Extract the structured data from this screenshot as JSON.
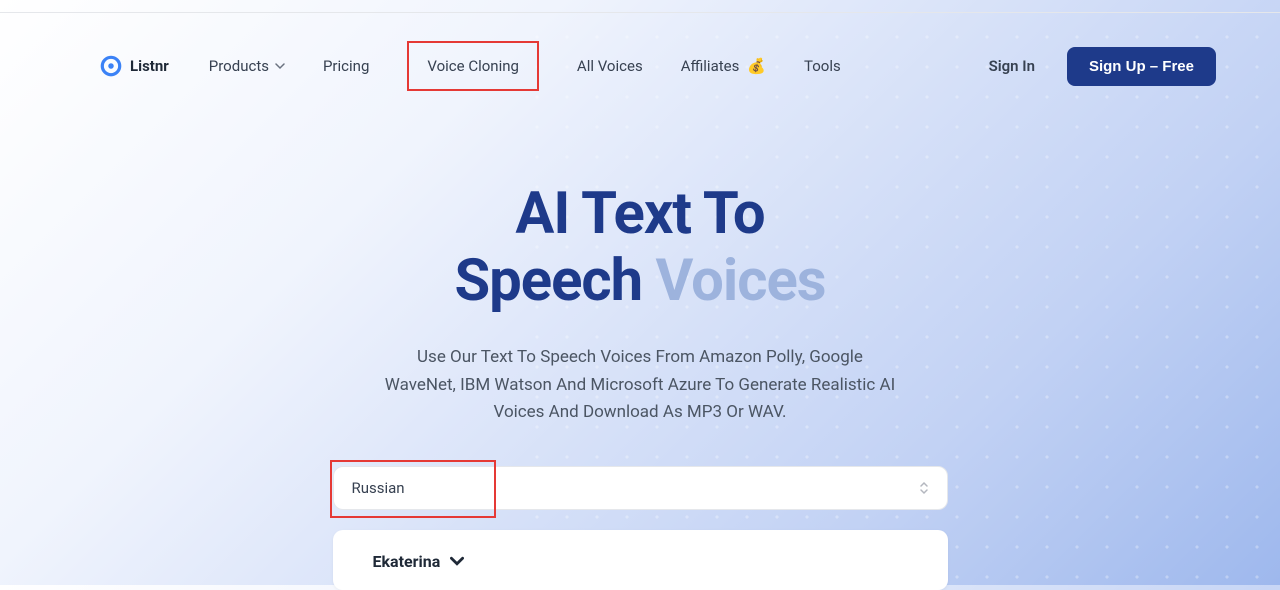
{
  "brand": {
    "name": "Listnr"
  },
  "nav": {
    "products": "Products",
    "pricing": "Pricing",
    "voice_cloning": "Voice Cloning",
    "all_voices": "All Voices",
    "affiliates": "Affiliates",
    "tools": "Tools"
  },
  "auth": {
    "sign_in": "Sign In",
    "sign_up": "Sign Up – Free"
  },
  "hero": {
    "title_line1_dark": "AI Text To",
    "title_line2_dark": "Speech",
    "title_line2_light": "Voices",
    "subtitle": "Use Our Text To Speech Voices From Amazon Polly, Google WaveNet, IBM Watson And Microsoft Azure To Generate Realistic AI Voices And Download As MP3 Or WAV."
  },
  "controls": {
    "language_value": "Russian",
    "voice_name": "Ekaterina"
  }
}
